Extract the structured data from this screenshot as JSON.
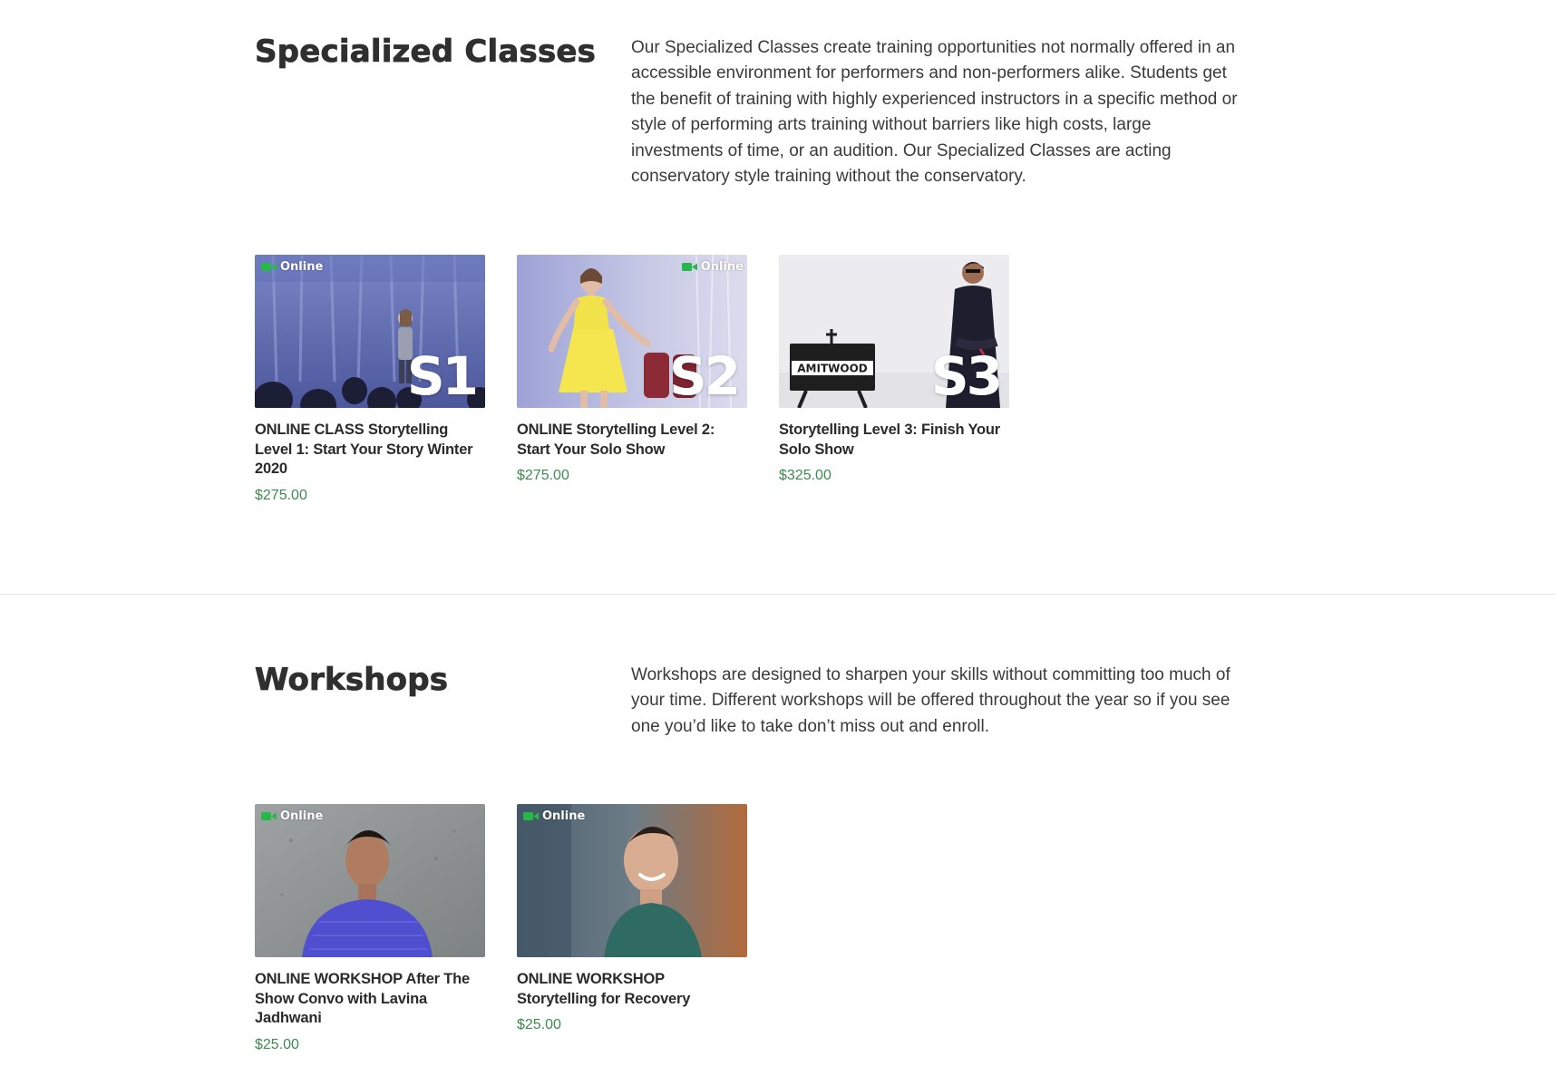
{
  "colors": {
    "price": "#3d8a4e",
    "online_icon": "#27b84a",
    "heading": "#2f2f2f",
    "divider": "#e6e6e6"
  },
  "specialized": {
    "title": "Specialized Classes",
    "description": "Our Specialized Classes create training opportunities not normally offered in an accessible environment for performers and non-performers alike. Students get the benefit of training with highly experienced instructors in a specific method or style of performing arts training without barriers like high costs, large investments of time, or an audition. Our Specialized Classes are acting conservatory style training without the conservatory.",
    "products": [
      {
        "badge": "Online",
        "overlay": "S1",
        "title": "ONLINE CLASS Storytelling Level 1: Start Your Story Winter 2020",
        "price": "$275.00"
      },
      {
        "badge": "Online",
        "overlay": "S2",
        "title": "ONLINE Storytelling Level 2: Start Your Solo Show",
        "price": "$275.00"
      },
      {
        "badge": "",
        "overlay": "S3",
        "sign": "AMITWOOD",
        "title": "Storytelling Level 3: Finish Your Solo Show",
        "price": "$325.00"
      }
    ]
  },
  "workshops": {
    "title": "Workshops",
    "description": "Workshops are designed to sharpen your skills without committing too much of your time. Different workshops will be offered throughout the year so if you see one you’d like to take don’t miss out and enroll.",
    "products": [
      {
        "badge": "Online",
        "title": "ONLINE WORKSHOP After The Show Convo with Lavina Jadhwani",
        "price": "$25.00"
      },
      {
        "badge": "Online",
        "title": "ONLINE WORKSHOP Storytelling for Recovery",
        "price": "$25.00"
      }
    ]
  }
}
